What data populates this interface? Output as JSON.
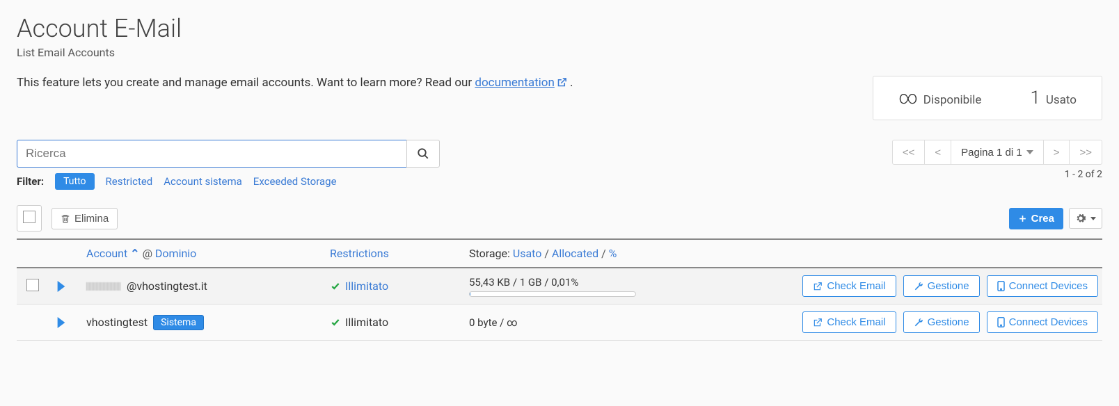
{
  "header": {
    "title": "Account E-Mail",
    "subtitle": "List Email Accounts"
  },
  "intro": {
    "text_before": "This feature lets you create and manage email accounts. Want to learn more? Read our ",
    "link_text": "documentation",
    "text_after": " ."
  },
  "stats": {
    "available_symbol": "∞",
    "available_label": "Disponibile",
    "used_value": "1",
    "used_label": "Usato"
  },
  "search": {
    "placeholder": "Ricerca"
  },
  "pager": {
    "first": "<<",
    "prev": "<",
    "page_label": "Pagina 1 di 1",
    "next": ">",
    "last": ">>",
    "range": "1 - 2 of 2"
  },
  "filters": {
    "label": "Filter:",
    "all": "Tutto",
    "restricted": "Restricted",
    "system": "Account sistema",
    "exceeded": "Exceeded Storage"
  },
  "toolbar": {
    "delete": "Elimina",
    "create": "Crea"
  },
  "columns": {
    "account": "Account",
    "at": "@",
    "domain": "Dominio",
    "restrictions": "Restrictions",
    "storage_prefix": "Storage:",
    "used": "Usato",
    "allocated": "Allocated",
    "percent": "%"
  },
  "actions": {
    "check_email": "Check Email",
    "manage": "Gestione",
    "connect": "Connect Devices"
  },
  "rows": [
    {
      "blurred_user": true,
      "address_suffix": "@vhostingtest.it",
      "system": false,
      "restriction": "Illimitato",
      "restriction_link": true,
      "storage_text": "55,43 KB / 1 GB / 0,01%",
      "progress_pct": 0.5,
      "has_checkbox": true
    },
    {
      "blurred_user": false,
      "address": "vhostingtest",
      "system": true,
      "system_label": "Sistema",
      "restriction": "Illimitato",
      "restriction_link": false,
      "storage_text": "0 byte / ∞",
      "progress_pct": null,
      "has_checkbox": false
    }
  ]
}
